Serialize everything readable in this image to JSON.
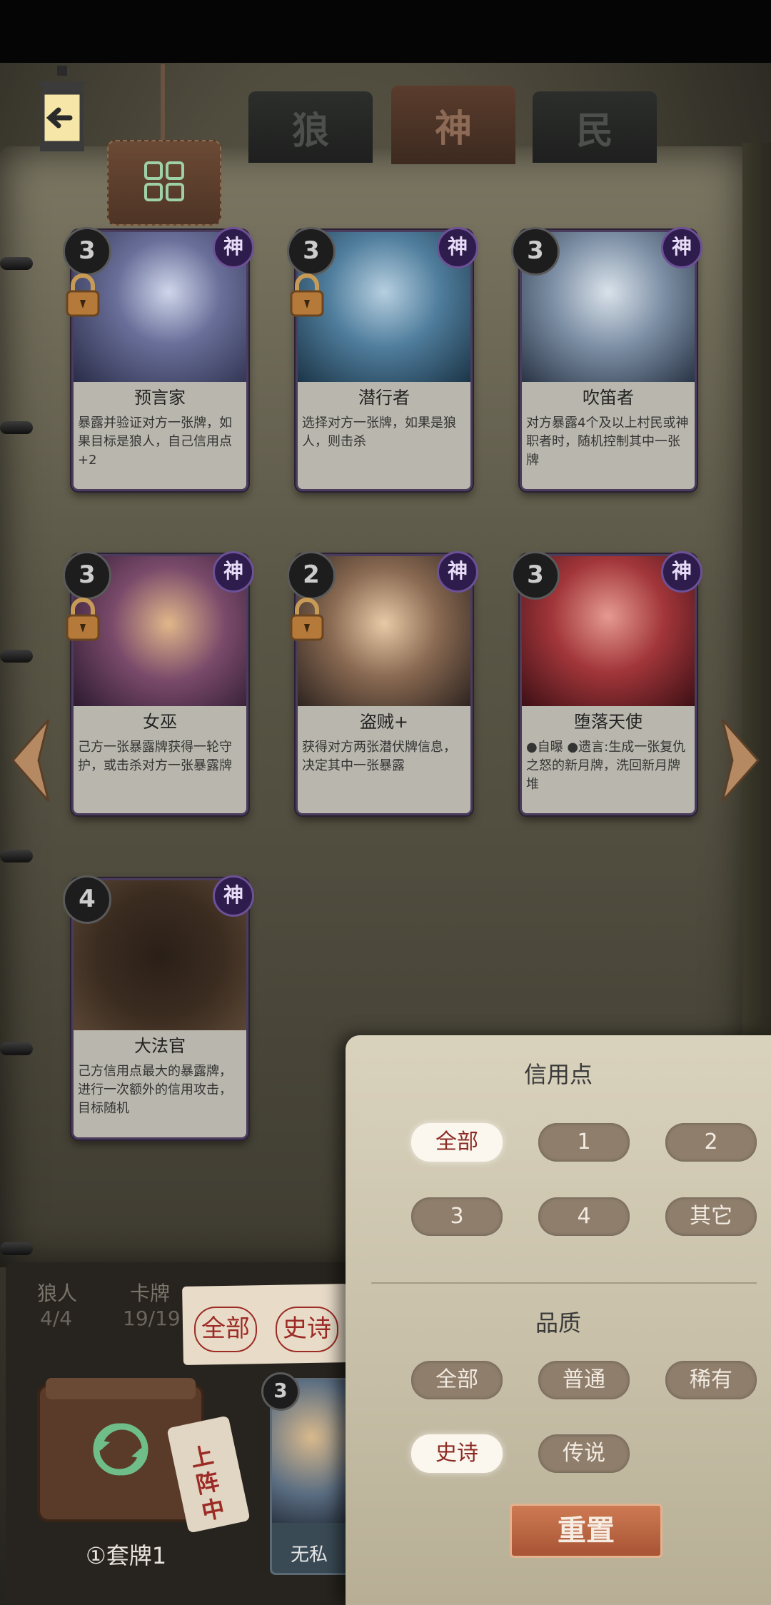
{
  "tabs": [
    {
      "label": "狼"
    },
    {
      "label": "神"
    },
    {
      "label": "民"
    }
  ],
  "cards": [
    {
      "cost": "3",
      "badge": "神",
      "name": "预言家",
      "desc": "暴露并验证对方一张牌，如果目标是狼人，自己信用点+2",
      "locked": true
    },
    {
      "cost": "3",
      "badge": "神",
      "name": "潜行者",
      "desc": "选择对方一张牌，如果是狼人，则击杀",
      "locked": true
    },
    {
      "cost": "3",
      "badge": "神",
      "name": "吹笛者",
      "desc": "对方暴露4个及以上村民或神职者时，随机控制其中一张牌",
      "locked": false
    },
    {
      "cost": "3",
      "badge": "神",
      "name": "女巫",
      "desc": "己方一张暴露牌获得一轮守护，或击杀对方一张暴露牌",
      "locked": true
    },
    {
      "cost": "2",
      "badge": "神",
      "name": "盗贼+",
      "desc": "获得对方两张潜伏牌信息，决定其中一张暴露",
      "locked": true
    },
    {
      "cost": "3",
      "badge": "神",
      "name": "堕落天使",
      "desc": "●自曝 ●遗言:生成一张复仇之怒的新月牌，洗回新月牌堆",
      "locked": false
    },
    {
      "cost": "4",
      "badge": "神",
      "name": "大法官",
      "desc": "己方信用点最大的暴露牌，进行一次额外的信用攻击，目标随机",
      "locked": false
    }
  ],
  "bottom": {
    "wolf_label": "狼人",
    "wolf_value": "4/4",
    "card_label": "卡牌",
    "card_value": "19/19",
    "deck_name": "①套牌1",
    "deck_tag": "上阵中",
    "mini_card_cost": "3",
    "mini_card_name": "无私"
  },
  "quick_filters": [
    "全部",
    "史诗"
  ],
  "filter": {
    "credit_title": "信用点",
    "credit_options": [
      {
        "label": "全部",
        "selected": true
      },
      {
        "label": "1",
        "selected": false
      },
      {
        "label": "2",
        "selected": false
      },
      {
        "label": "3",
        "selected": false
      },
      {
        "label": "4",
        "selected": false
      },
      {
        "label": "其它",
        "selected": false
      }
    ],
    "quality_title": "品质",
    "quality_options": [
      {
        "label": "全部",
        "selected": false
      },
      {
        "label": "普通",
        "selected": false
      },
      {
        "label": "稀有",
        "selected": false
      },
      {
        "label": "史诗",
        "selected": true
      },
      {
        "label": "传说",
        "selected": false
      }
    ],
    "reset_label": "重置"
  },
  "colors": {
    "god_badge": "#2e1c4c",
    "accent_brown": "#a85435",
    "selected_chip": "#fbf7ef",
    "chip": "#8f7e6c"
  }
}
